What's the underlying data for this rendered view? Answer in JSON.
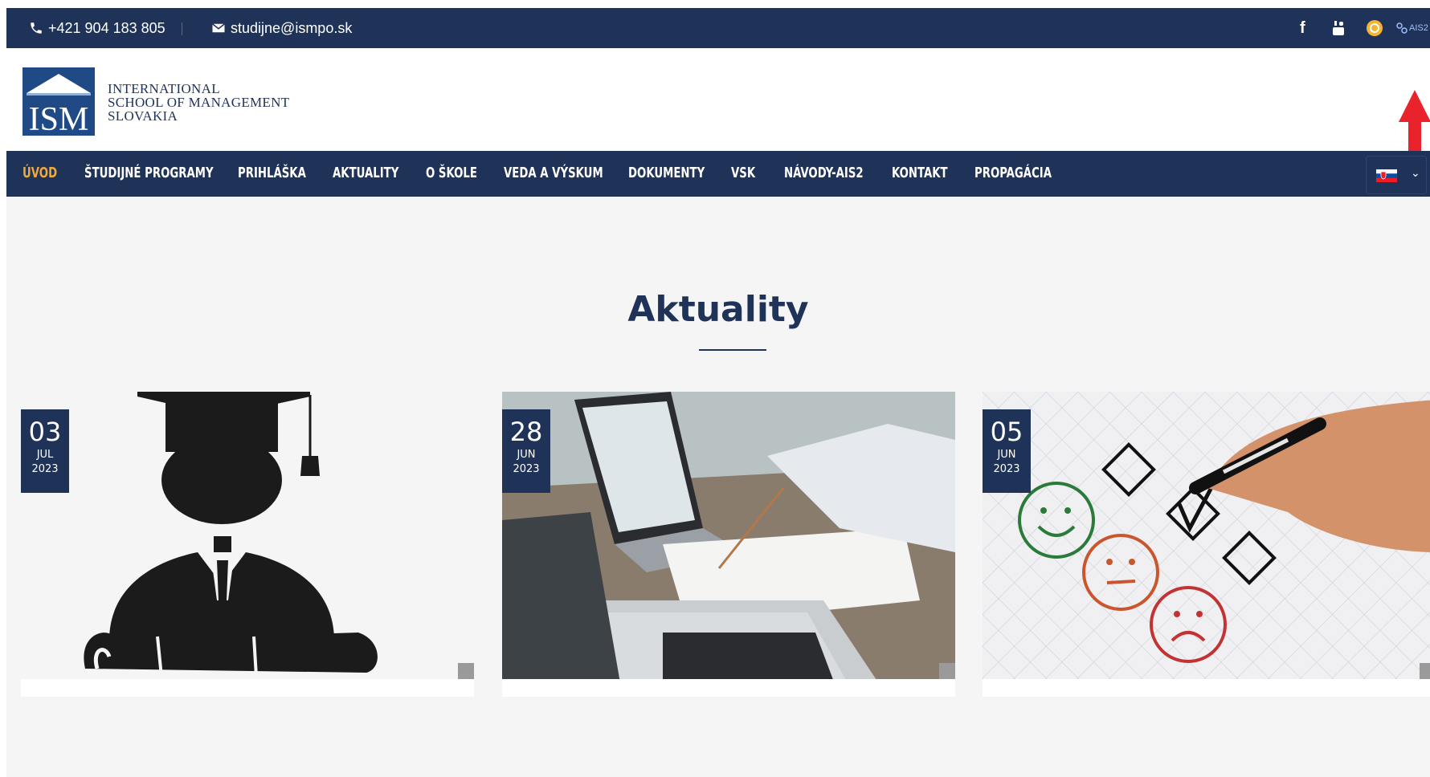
{
  "topbar": {
    "phone": "+421 904 183 805",
    "email": "studijne@ismpo.sk",
    "social_ais_label": "AIS2"
  },
  "logo": {
    "mark": "ISM",
    "line1": "INTERNATIONAL",
    "line2": "SCHOOL OF MANAGEMENT",
    "line3": "SLOVAKIA"
  },
  "nav": {
    "items": [
      {
        "label": "ÚVOD"
      },
      {
        "label": "ŠTUDIJNÉ PROGRAMY"
      },
      {
        "label": "PRIHLÁŠKA"
      },
      {
        "label": "AKTUALITY"
      },
      {
        "label": "O ŠKOLE"
      },
      {
        "label": "VEDA A VÝSKUM"
      },
      {
        "label": "DOKUMENTY"
      },
      {
        "label": "VSK"
      },
      {
        "label": "NÁVODY-AIS2"
      },
      {
        "label": "KONTAKT"
      },
      {
        "label": "PROPAGÁCIA"
      }
    ],
    "active_index": 0,
    "language_icon": "slovak-flag-icon"
  },
  "main": {
    "title": "Aktuality"
  },
  "news": [
    {
      "day": "03",
      "month": "JUL",
      "year": "2023",
      "image": "graduate-silhouette"
    },
    {
      "day": "28",
      "month": "JUN",
      "year": "2023",
      "image": "laptop-writing-photo"
    },
    {
      "day": "05",
      "month": "JUN",
      "year": "2023",
      "image": "survey-smileys-photo"
    }
  ],
  "colors": {
    "navy": "#1f3258",
    "active": "#f0a93b",
    "annotation_arrow": "#e8232b"
  }
}
